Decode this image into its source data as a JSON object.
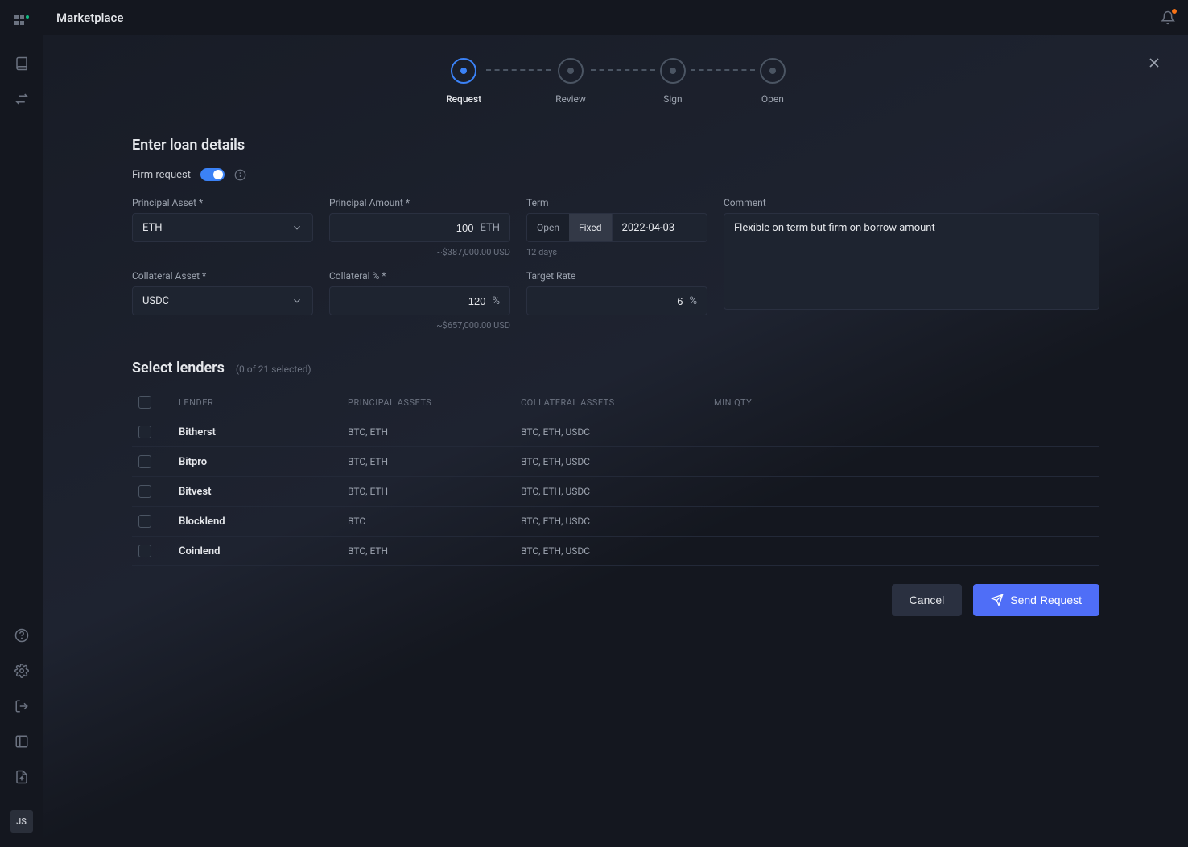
{
  "app": {
    "title": "Marketplace",
    "avatar": "JS"
  },
  "stepper": {
    "steps": [
      "Request",
      "Review",
      "Sign",
      "Open"
    ],
    "activeIndex": 0
  },
  "loan": {
    "heading": "Enter loan details",
    "firmRequestLabel": "Firm request",
    "firmRequestOn": true,
    "principalAsset": {
      "label": "Principal Asset *",
      "value": "ETH"
    },
    "principalAmount": {
      "label": "Principal Amount *",
      "value": "100",
      "unit": "ETH",
      "hint": "~$387,000.00  USD"
    },
    "term": {
      "label": "Term",
      "open": "Open",
      "fixed": "Fixed",
      "mode": "Fixed",
      "date": "2022-04-03",
      "hint": "12 days"
    },
    "comment": {
      "label": "Comment",
      "value": "Flexible on term but firm on borrow amount"
    },
    "collateralAsset": {
      "label": "Collateral Asset *",
      "value": "USDC"
    },
    "collateralPct": {
      "label": "Collateral % *",
      "value": "120",
      "unit": "%",
      "hint": "~$657,000.00 USD"
    },
    "targetRate": {
      "label": "Target Rate",
      "value": "6",
      "unit": "%"
    }
  },
  "lenders": {
    "heading": "Select lenders",
    "count": "(0  of 21 selected)",
    "columns": {
      "lender": "LENDER",
      "principal": "PRINCIPAL ASSETS",
      "collateral": "COLLATERAL ASSETS",
      "minqty": "MIN QTY"
    },
    "rows": [
      {
        "name": "Bitherst",
        "principal": "BTC, ETH",
        "collateral": "BTC, ETH, USDC",
        "minqty": ""
      },
      {
        "name": "Bitpro",
        "principal": "BTC, ETH",
        "collateral": "BTC, ETH, USDC",
        "minqty": ""
      },
      {
        "name": "Bitvest",
        "principal": "BTC, ETH",
        "collateral": "BTC, ETH, USDC",
        "minqty": ""
      },
      {
        "name": "Blocklend",
        "principal": "BTC",
        "collateral": "BTC, ETH, USDC",
        "minqty": ""
      },
      {
        "name": "Coinlend",
        "principal": "BTC, ETH",
        "collateral": "BTC, ETH, USDC",
        "minqty": ""
      }
    ]
  },
  "actions": {
    "cancel": "Cancel",
    "send": "Send Request"
  }
}
